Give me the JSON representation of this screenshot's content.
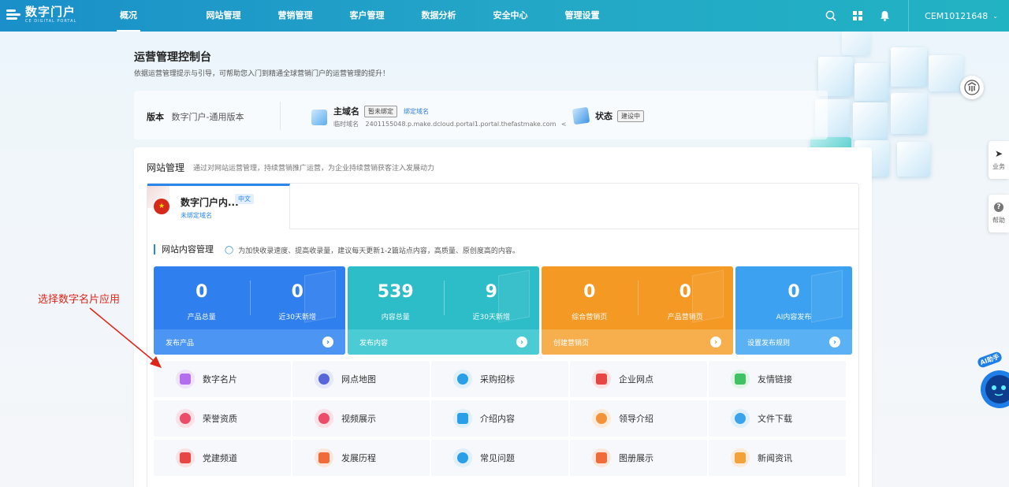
{
  "app": {
    "logo_cn": "数字门户",
    "logo_en": "CE DIGITAL PORTAL"
  },
  "nav": [
    {
      "label": "概况",
      "active": true
    },
    {
      "label": "网站管理"
    },
    {
      "label": "营销管理"
    },
    {
      "label": "客户管理"
    },
    {
      "label": "数据分析"
    },
    {
      "label": "安全中心"
    },
    {
      "label": "管理设置"
    }
  ],
  "top_icons": [
    "search-icon",
    "apps-grid-icon",
    "bell-icon"
  ],
  "user": {
    "account": "CEM10121648"
  },
  "header": {
    "title": "运营管理控制台",
    "subtitle": "依据运营管理提示与引导，可帮助您入门到精通全球营销门户的运营管理的提升！"
  },
  "info": {
    "version_label": "版本",
    "version_value": "数字门户-通用版本",
    "domain_label": "主域名",
    "domain_tag": "暂未绑定",
    "bind_link": "绑定域名",
    "temp_domain_label": "临时域名",
    "temp_domain_value": "2401155048.p.make.dcloud.portal1.portal.thefastmake.com",
    "status_label": "状态",
    "status_tag": "建设中"
  },
  "website": {
    "title": "网站管理",
    "desc": "通过对网站运营管理，持续营销推广运营，为企业持续营销获客注入发展动力",
    "site_name": "数字门户内...",
    "site_lang": "中文",
    "site_domain_status": "未绑定域名",
    "content_title": "网站内容管理",
    "content_tip": "为加快收录速度、提高收录量，建议每天更新1-2篇站点内容，高质量、原创度高的内容。"
  },
  "stats": [
    {
      "color": "blue",
      "items": [
        {
          "value": "0",
          "label": "产品总量"
        },
        {
          "value": "0",
          "label": "近30天新增"
        }
      ],
      "action": "发布产品"
    },
    {
      "color": "teal",
      "items": [
        {
          "value": "539",
          "label": "内容总量"
        },
        {
          "value": "9",
          "label": "近30天新增"
        }
      ],
      "action": "发布内容"
    },
    {
      "color": "orange",
      "items": [
        {
          "value": "0",
          "label": "综合营销页"
        },
        {
          "value": "0",
          "label": "产品营销页"
        }
      ],
      "action": "创建营销页"
    },
    {
      "color": "sky",
      "items": [
        {
          "value": "0",
          "label": "AI内容发布"
        }
      ],
      "action": "设置发布规则"
    }
  ],
  "apps": [
    {
      "label": "数字名片",
      "icon": "business-card-icon",
      "bg": "#f1e2fb",
      "fg": "#b36ef0"
    },
    {
      "label": "网点地图",
      "icon": "map-icon",
      "bg": "#e5e8fb",
      "fg": "#5866d9"
    },
    {
      "label": "采购招标",
      "icon": "target-icon",
      "bg": "#dff0fb",
      "fg": "#2b9ee8"
    },
    {
      "label": "企业网点",
      "icon": "location-pin-icon",
      "bg": "#fbe1e1",
      "fg": "#e84545"
    },
    {
      "label": "友情链接",
      "icon": "link-icon",
      "bg": "#dff5e5",
      "fg": "#3fc164"
    },
    {
      "label": "荣誉资质",
      "icon": "award-icon",
      "bg": "#fbe1e6",
      "fg": "#ec4c68"
    },
    {
      "label": "视频展示",
      "icon": "video-icon",
      "bg": "#fbe1e6",
      "fg": "#ec4c68"
    },
    {
      "label": "介绍内容",
      "icon": "building-icon",
      "bg": "#dff0fb",
      "fg": "#2b9ee8"
    },
    {
      "label": "领导介绍",
      "icon": "person-icon",
      "bg": "#fdebd9",
      "fg": "#f2923a"
    },
    {
      "label": "文件下载",
      "icon": "download-icon",
      "bg": "#dff0fb",
      "fg": "#3aa3ec"
    },
    {
      "label": "党建频道",
      "icon": "party-icon",
      "bg": "#fbe1e1",
      "fg": "#e84545"
    },
    {
      "label": "发展历程",
      "icon": "chart-up-icon",
      "bg": "#fde6dc",
      "fg": "#f06b3a"
    },
    {
      "label": "常见问题",
      "icon": "question-icon",
      "bg": "#dff0fb",
      "fg": "#2b9ee8"
    },
    {
      "label": "图册展示",
      "icon": "album-icon",
      "bg": "#fde6dc",
      "fg": "#f06b3a"
    },
    {
      "label": "新闻资讯",
      "icon": "news-icon",
      "bg": "#fdebd9",
      "fg": "#f2a23a"
    }
  ],
  "annotation": {
    "text": "选择数字名片应用",
    "color": "#e0261b"
  },
  "side": {
    "business": "业务",
    "help": "帮助",
    "ai_label": "AI助手"
  }
}
